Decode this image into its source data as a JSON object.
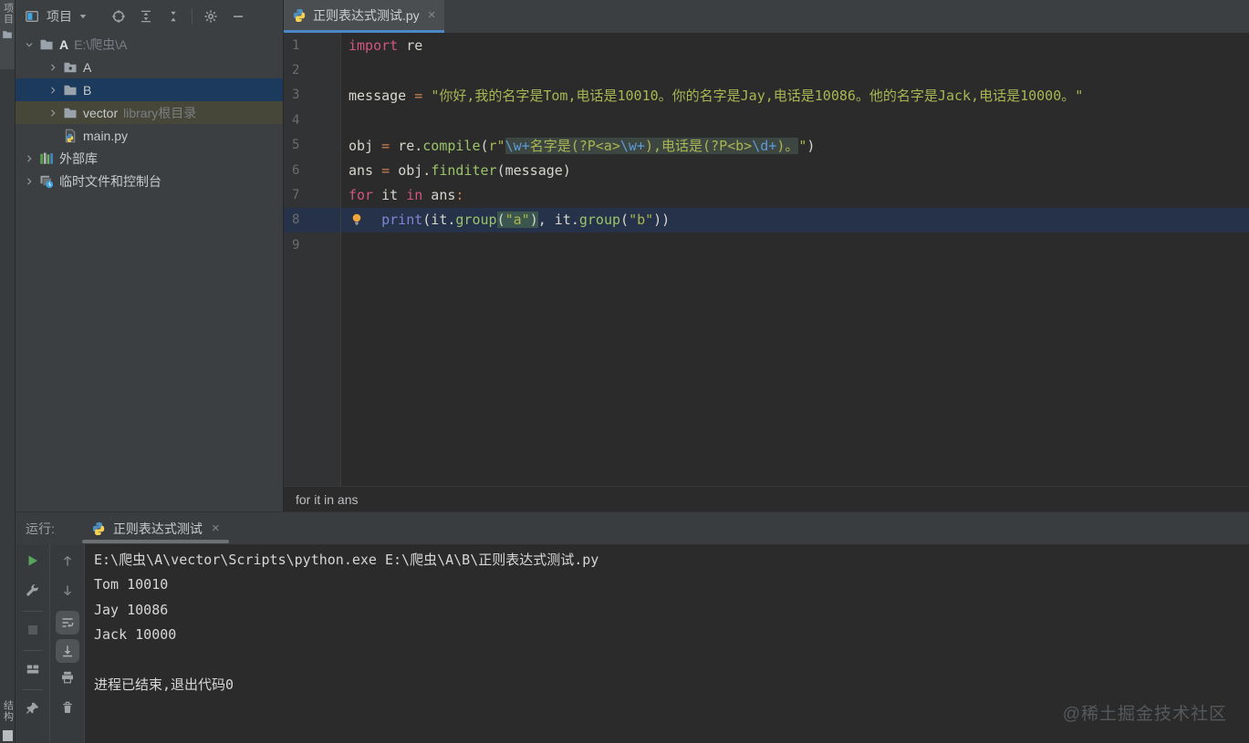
{
  "window": {
    "watermark": "@稀土掘金技术社区"
  },
  "left_stripe": {
    "top_label": "项目",
    "bottom_label": "结构"
  },
  "project_panel": {
    "header": {
      "title": "项目",
      "icons": [
        "locate",
        "expand-all",
        "collapse-all",
        "separator",
        "settings-gear",
        "hide"
      ]
    },
    "tree": [
      {
        "level": 0,
        "chevron": "down",
        "icon": "folder",
        "name": "A",
        "bold": true,
        "suffix": "E:\\爬虫\\A"
      },
      {
        "level": 1,
        "chevron": "right",
        "icon": "folder-dot",
        "name": "A"
      },
      {
        "level": 1,
        "chevron": "right",
        "icon": "folder",
        "name": "B",
        "selected": true
      },
      {
        "level": 1,
        "chevron": "right",
        "icon": "folder",
        "name": "vector",
        "suffix": "library根目录",
        "library": true
      },
      {
        "level": 1,
        "chevron": "none",
        "icon": "python-file",
        "name": "main.py"
      },
      {
        "level": 0,
        "chevron": "right",
        "icon": "libraries",
        "name": "外部库"
      },
      {
        "level": 0,
        "chevron": "right",
        "icon": "scratches",
        "name": "临时文件和控制台"
      }
    ]
  },
  "editor": {
    "tab": {
      "icon": "python-logo",
      "title": "正则表达式测试.py",
      "close": "×"
    },
    "breadcrumb": "for it in ans",
    "lines": [
      {
        "n": "1",
        "segs": [
          {
            "t": "import",
            "c": "kw"
          },
          {
            "t": " re",
            "c": "fg"
          }
        ]
      },
      {
        "n": "2",
        "segs": []
      },
      {
        "n": "3",
        "segs": [
          {
            "t": "message ",
            "c": "fg"
          },
          {
            "t": "= ",
            "c": "op"
          },
          {
            "t": "\"你好,我的名字是Tom,电话是10010。你的名字是Jay,电话是10086。他的名字是Jack,电话是10000。\"",
            "c": "str"
          }
        ]
      },
      {
        "n": "4",
        "segs": []
      },
      {
        "n": "5",
        "segs": [
          {
            "t": "obj ",
            "c": "fg"
          },
          {
            "t": "= ",
            "c": "op"
          },
          {
            "t": "re.",
            "c": "fg"
          },
          {
            "t": "compile",
            "c": "fn"
          },
          {
            "t": "(",
            "c": "fg"
          },
          {
            "t": "r\"",
            "c": "str"
          },
          {
            "t": "\\w+",
            "c": "esc",
            "h": 1
          },
          {
            "t": "名字是(?P<a>",
            "c": "str",
            "h": 1
          },
          {
            "t": "\\w+",
            "c": "esc",
            "h": 1
          },
          {
            "t": "),电话是(?P<b>",
            "c": "str",
            "h": 1
          },
          {
            "t": "\\d+",
            "c": "esc",
            "h": 1
          },
          {
            "t": ")。",
            "c": "str",
            "h": 1
          },
          {
            "t": "\"",
            "c": "str"
          },
          {
            "t": ")",
            "c": "fg"
          }
        ]
      },
      {
        "n": "6",
        "segs": [
          {
            "t": "ans ",
            "c": "fg"
          },
          {
            "t": "= ",
            "c": "op"
          },
          {
            "t": "obj.",
            "c": "fg"
          },
          {
            "t": "finditer",
            "c": "fn"
          },
          {
            "t": "(message)",
            "c": "fg"
          }
        ]
      },
      {
        "n": "7",
        "segs": [
          {
            "t": "for",
            "c": "kw"
          },
          {
            "t": " it ",
            "c": "fg"
          },
          {
            "t": "in",
            "c": "kw"
          },
          {
            "t": " ans",
            "c": "fg"
          },
          {
            "t": ":",
            "c": "op"
          }
        ]
      },
      {
        "n": "8",
        "current": true,
        "bulb": true,
        "segs": [
          {
            "t": "    ",
            "c": "fg"
          },
          {
            "t": "print",
            "c": "builtin"
          },
          {
            "t": "(it.",
            "c": "fg"
          },
          {
            "t": "group",
            "c": "fn"
          },
          {
            "t": "(",
            "c": "fg",
            "m": 1
          },
          {
            "t": "\"a\"",
            "c": "str",
            "m": 1
          },
          {
            "t": ")",
            "c": "fg",
            "m": 1
          },
          {
            "t": ", it.",
            "c": "fg"
          },
          {
            "t": "group",
            "c": "fn"
          },
          {
            "t": "(",
            "c": "fg"
          },
          {
            "t": "\"b\"",
            "c": "str"
          },
          {
            "t": "))",
            "c": "fg"
          }
        ]
      },
      {
        "n": "9",
        "segs": []
      }
    ]
  },
  "run_panel": {
    "label": "运行:",
    "tab": {
      "icon": "python-logo",
      "title": "正则表达式测试",
      "close": "×"
    },
    "toolbar_left": [
      {
        "icon": "rerun"
      },
      {
        "icon": "wrench"
      },
      {
        "divider": true
      },
      {
        "icon": "stop",
        "disabled": true
      },
      {
        "divider": true
      },
      {
        "icon": "restore-layout"
      },
      {
        "divider": true
      },
      {
        "icon": "pin"
      }
    ],
    "toolbar_right": [
      {
        "icon": "arrow-up"
      },
      {
        "icon": "arrow-down"
      },
      {
        "icon": "soft-wrap",
        "toggled": true
      },
      {
        "icon": "scroll-to-end",
        "toggled": true
      },
      {
        "icon": "printer"
      },
      {
        "icon": "trash"
      }
    ],
    "console_lines": [
      "E:\\爬虫\\A\\vector\\Scripts\\python.exe E:\\爬虫\\A\\B\\正则表达式测试.py",
      "Tom 10010",
      "Jay 10086",
      "Jack 10000",
      "",
      "进程已结束,退出代码0"
    ]
  }
}
